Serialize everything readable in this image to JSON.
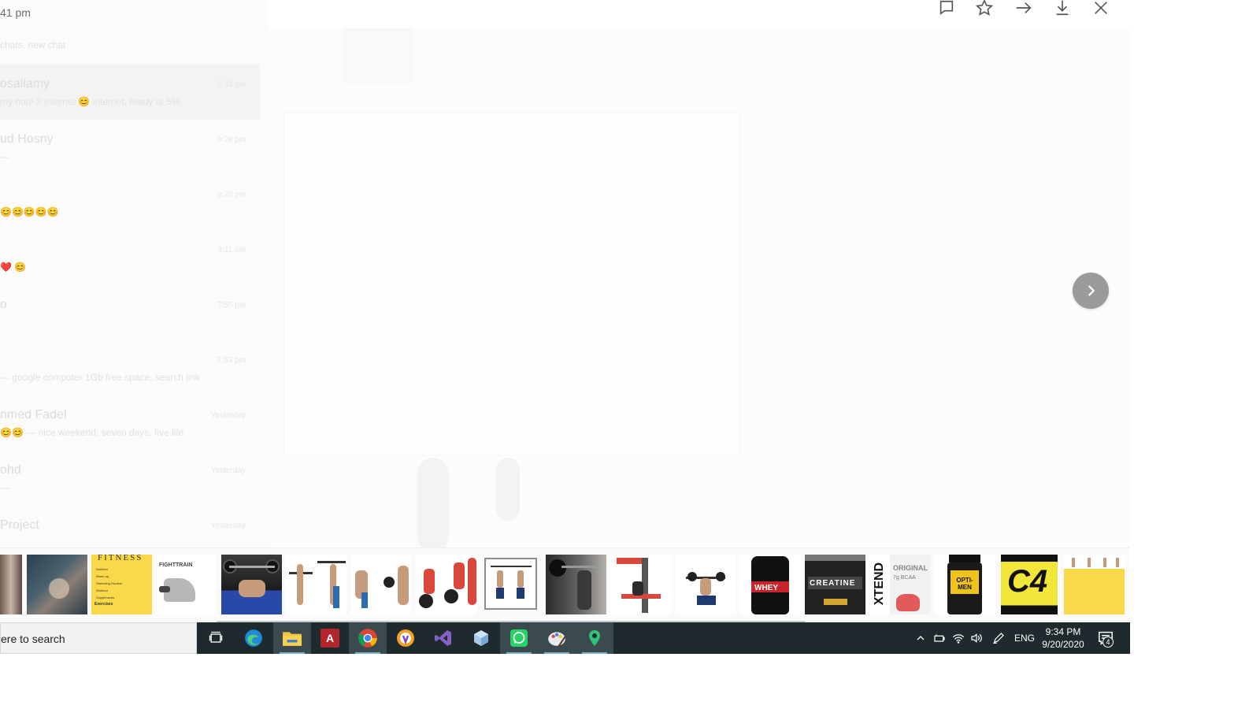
{
  "status": {
    "time_fragment": "41 pm"
  },
  "background_chat": {
    "header": "chats, new chat",
    "rows": [
      {
        "name": "osallamy",
        "preview": "my note 2 internet 😊 internet, ready at 5%",
        "time": "9:33 pm",
        "selected": true
      },
      {
        "name": "ud Hosny",
        "preview": "—",
        "time": "9:28 pm",
        "selected": false
      },
      {
        "name": "",
        "preview": "😊😊😊😊😊",
        "time": "9:20 pm",
        "selected": false
      },
      {
        "name": "",
        "preview": "❤️ 😊",
        "time": "9:11 pm",
        "selected": false
      },
      {
        "name": "o",
        "preview": "",
        "time": "7:55 pm",
        "selected": false
      },
      {
        "name": "",
        "preview": "— google computer 1Gb free space, search link",
        "time": "7:53 pm",
        "selected": false
      },
      {
        "name": "nmed Fadel",
        "preview": "😊😊 — nice weekend, seven days, five life",
        "time": "Yesterday",
        "selected": false
      },
      {
        "name": "ohd",
        "preview": "—",
        "time": "Yesterday",
        "selected": false
      },
      {
        "name": "Project",
        "preview": "",
        "time": "Yesterday",
        "selected": false
      }
    ]
  },
  "toolbar": {
    "icons": [
      "reply-icon",
      "star-icon",
      "forward-icon",
      "download-icon",
      "close-icon"
    ]
  },
  "viewer": {
    "next_icon": "chevron-right-icon"
  },
  "thumbnails": [
    {
      "name": "thumb-gym-people",
      "kind": "photo"
    },
    {
      "name": "thumb-lifting-hands",
      "kind": "photo"
    },
    {
      "name": "thumb-fitness-flyer",
      "kind": "text",
      "label": "FITNESS",
      "lines": [
        "Nutrition",
        "Warm up",
        "Stretching Routine",
        "Workout",
        "Supplements"
      ],
      "footer": "Exercises"
    },
    {
      "name": "thumb-incline-press-diagram",
      "kind": "diagram",
      "label": "FIGHTTRAIN"
    },
    {
      "name": "thumb-bench-press",
      "kind": "photo"
    },
    {
      "name": "thumb-barbell-curl",
      "kind": "diagram"
    },
    {
      "name": "thumb-dumbbell-row",
      "kind": "diagram"
    },
    {
      "name": "thumb-deadlift",
      "kind": "diagram"
    },
    {
      "name": "thumb-pull-up",
      "kind": "diagram",
      "selected": true
    },
    {
      "name": "thumb-barbell-squat-photo",
      "kind": "photo"
    },
    {
      "name": "thumb-leg-machine",
      "kind": "diagram"
    },
    {
      "name": "thumb-lunge",
      "kind": "diagram"
    },
    {
      "name": "thumb-whey",
      "kind": "product",
      "label": "WHEY"
    },
    {
      "name": "thumb-creatine",
      "kind": "product",
      "label": "CREATINE"
    },
    {
      "name": "thumb-xtend-bcaa",
      "kind": "product",
      "label": "XTEND",
      "sub": "ORIGINAL",
      "sub2": "7g BCAA"
    },
    {
      "name": "thumb-opti-men",
      "kind": "product",
      "label": "OPTI-MEN"
    },
    {
      "name": "thumb-c4",
      "kind": "product",
      "label": "C4"
    },
    {
      "name": "thumb-workout-chart",
      "kind": "diagram"
    }
  ],
  "taskbar": {
    "search_placeholder": "ere to search",
    "apps": [
      {
        "name": "task-view-icon",
        "active": false
      },
      {
        "name": "edge-icon",
        "active": false
      },
      {
        "name": "file-explorer-icon",
        "active": true
      },
      {
        "name": "access-icon",
        "active": false
      },
      {
        "name": "chrome-icon",
        "active": true
      },
      {
        "name": "vpn-icon",
        "active": false
      },
      {
        "name": "visual-studio-icon",
        "active": false
      },
      {
        "name": "3d-box-icon",
        "active": false
      },
      {
        "name": "whatsapp-icon",
        "active": true
      },
      {
        "name": "paint-icon",
        "active": true
      },
      {
        "name": "maps-icon",
        "active": true
      }
    ],
    "tray": {
      "lang": "ENG",
      "time": "9:34 PM",
      "date": "9/20/2020",
      "notifications": "4"
    }
  },
  "colors": {
    "taskbar": "#1f2a2e",
    "accent": "#7fb2d0",
    "yellow": "#f9d84a",
    "next_button": "#9a9a9a"
  }
}
